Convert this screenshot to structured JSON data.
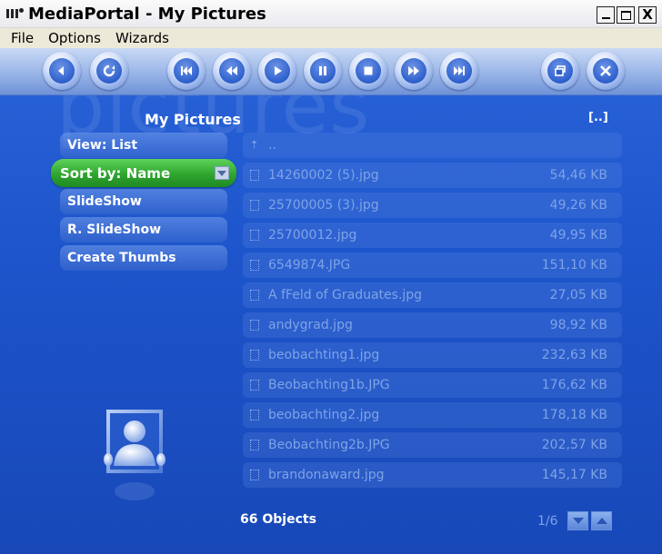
{
  "window": {
    "title": "MediaPortal - My Pictures",
    "min": "_",
    "max": "□",
    "close": "X"
  },
  "menubar": {
    "file": "File",
    "options": "Options",
    "wizards": "Wizards"
  },
  "watermark": "pictures",
  "header": {
    "title": "My Pictures",
    "parent": "[..]"
  },
  "left_menu": [
    {
      "label": "View: List"
    },
    {
      "label": "Sort by: Name"
    },
    {
      "label": "SlideShow"
    },
    {
      "label": "R. SlideShow"
    },
    {
      "label": "Create Thumbs"
    }
  ],
  "files": [
    {
      "name": "..",
      "size": ""
    },
    {
      "name": "14260002 (5).jpg",
      "size": "54,46 KB"
    },
    {
      "name": "25700005 (3).jpg",
      "size": "49,26 KB"
    },
    {
      "name": "25700012.jpg",
      "size": "49,95 KB"
    },
    {
      "name": "6549874.JPG",
      "size": "151,10 KB"
    },
    {
      "name": "A fFeld of Graduates.jpg",
      "size": "27,05 KB"
    },
    {
      "name": "andygrad.jpg",
      "size": "98,92 KB"
    },
    {
      "name": "beobachting1.jpg",
      "size": "232,63 KB"
    },
    {
      "name": "Beobachting1b.JPG",
      "size": "176,62 KB"
    },
    {
      "name": "beobachting2.jpg",
      "size": "178,18 KB"
    },
    {
      "name": "Beobachting2b.JPG",
      "size": "202,57 KB"
    },
    {
      "name": "brandonaward.jpg",
      "size": "145,17 KB"
    }
  ],
  "footer": {
    "objects": "66 Objects",
    "page": "1/6"
  }
}
